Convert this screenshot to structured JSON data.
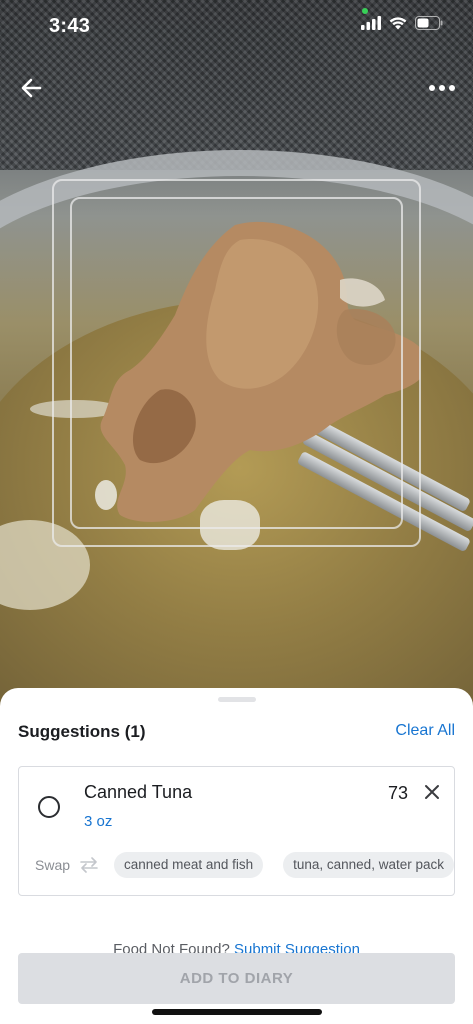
{
  "status_bar": {
    "time": "3:43",
    "icons": [
      "signal-icon",
      "wifi-icon",
      "battery-icon"
    ]
  },
  "nav": {
    "back_icon": "arrow-left-icon",
    "more_icon": "more-horizontal-icon"
  },
  "sheet": {
    "title": "Suggestions (1)",
    "clear_all": "Clear All",
    "suggestion": {
      "name": "Canned Tuna",
      "calories": "73",
      "serving": "3 oz",
      "swap_label": "Swap",
      "swap_options": [
        "canned meat and fish",
        "tuna, canned, water pack"
      ]
    },
    "not_found_text": "Food Not Found?",
    "submit_link": "Submit Suggestion",
    "add_button": "ADD TO DIARY"
  },
  "colors": {
    "accent": "#1875d1",
    "button_disabled_bg": "#dcdee2",
    "button_disabled_text": "#a1a4aa"
  }
}
